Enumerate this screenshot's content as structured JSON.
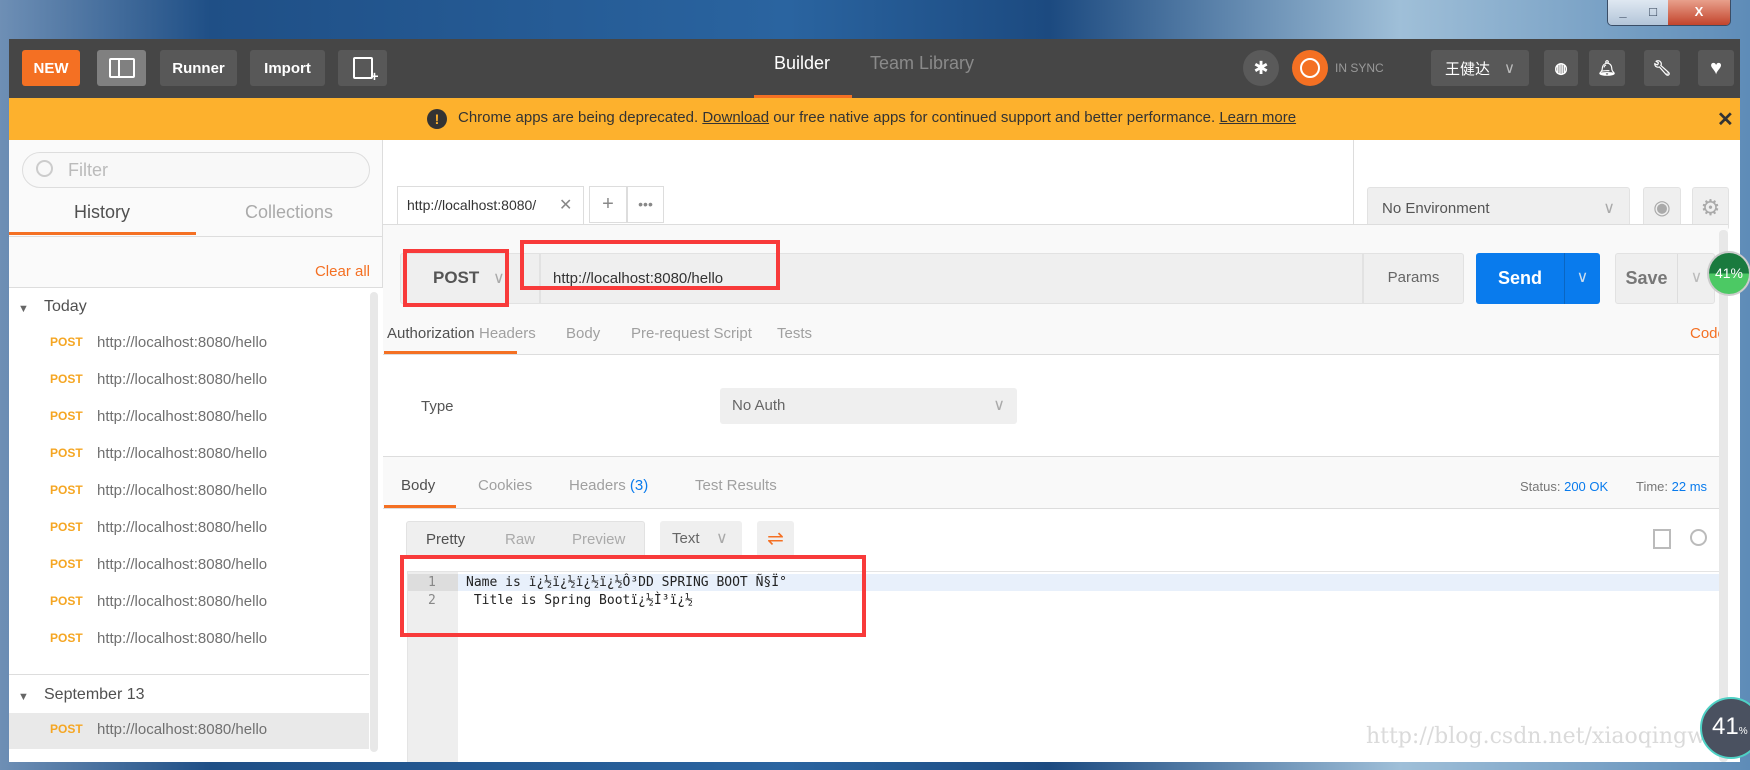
{
  "header": {
    "new_label": "NEW",
    "runner_label": "Runner",
    "import_label": "Import",
    "tabs": [
      "Builder",
      "Team Library"
    ],
    "sync_status": "IN SYNC",
    "user_name": "王健达"
  },
  "banner": {
    "prefix": "Chrome apps are being deprecated.",
    "download_link": "Download",
    "middle": "our free native apps for continued support and better performance.",
    "learn_more": "Learn more"
  },
  "sidebar": {
    "filter_placeholder": "Filter",
    "tabs": [
      "History",
      "Collections"
    ],
    "clear_all": "Clear all",
    "groups": [
      {
        "label": "Today",
        "items": [
          {
            "method": "POST",
            "url": "http://localhost:8080/hello"
          },
          {
            "method": "POST",
            "url": "http://localhost:8080/hello"
          },
          {
            "method": "POST",
            "url": "http://localhost:8080/hello"
          },
          {
            "method": "POST",
            "url": "http://localhost:8080/hello"
          },
          {
            "method": "POST",
            "url": "http://localhost:8080/hello"
          },
          {
            "method": "POST",
            "url": "http://localhost:8080/hello"
          },
          {
            "method": "POST",
            "url": "http://localhost:8080/hello"
          },
          {
            "method": "POST",
            "url": "http://localhost:8080/hello"
          },
          {
            "method": "POST",
            "url": "http://localhost:8080/hello"
          }
        ]
      },
      {
        "label": "September 13",
        "items": [
          {
            "method": "POST",
            "url": "http://localhost:8080/hello"
          }
        ]
      }
    ]
  },
  "request": {
    "tab_title": "http://localhost:8080/",
    "method": "POST",
    "url": "http://localhost:8080/hello",
    "params": "Params",
    "send": "Send",
    "save": "Save",
    "tabs": [
      "Authorization",
      "Headers",
      "Body",
      "Pre-request Script",
      "Tests"
    ],
    "code_link": "Code",
    "auth_type_label": "Type",
    "auth_type": "No Auth"
  },
  "environment": {
    "selected": "No Environment"
  },
  "response": {
    "tabs": [
      "Body",
      "Cookies",
      "Headers",
      "Test Results"
    ],
    "headers_count": "(3)",
    "status_label": "Status:",
    "status": "200 OK",
    "time_label": "Time:",
    "time": "22 ms",
    "views": [
      "Pretty",
      "Raw",
      "Preview"
    ],
    "format": "Text",
    "lines": [
      {
        "n": "1",
        "text": "Name is ï¿½ï¿½ï¿½ï¿½Ô³DD SPRING BOOT Ñ§Ï°"
      },
      {
        "n": "2",
        "text": " Title is Spring Bootï¿½Ì³ï¿½"
      }
    ]
  },
  "overlay": {
    "cpu_badge": "41%",
    "cpu_widget": "41",
    "cpu_widget_unit": "%",
    "watermark": "http://blog.csdn.net/xiaoqingwuku"
  },
  "colors": {
    "accent": "#f47023",
    "send": "#097bed",
    "banner": "#fdb12d",
    "highlight": "#f83a3a"
  }
}
